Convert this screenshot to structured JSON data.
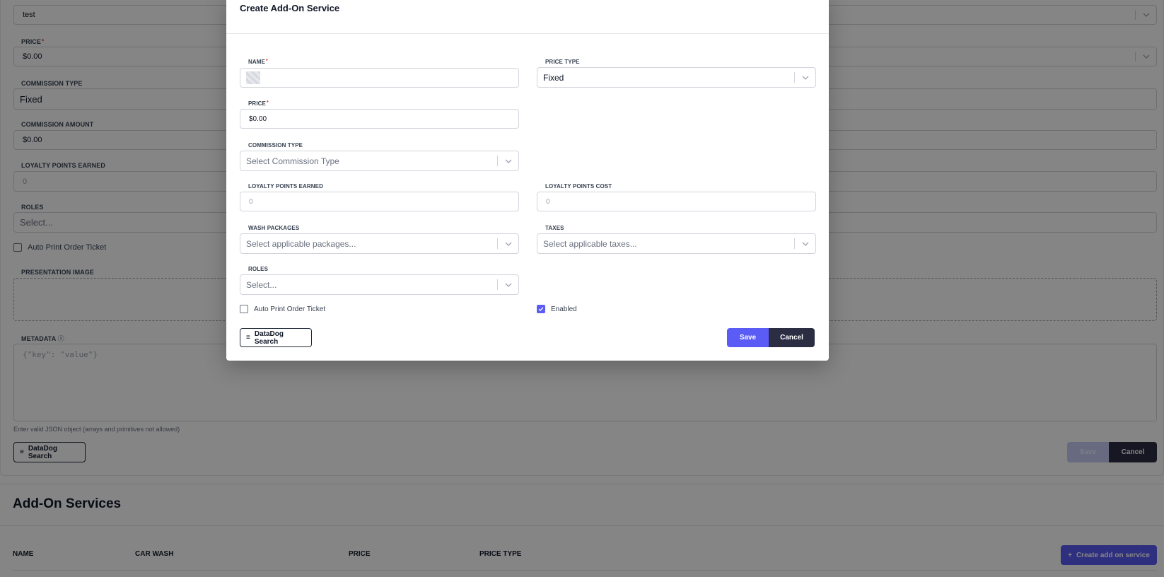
{
  "background_form": {
    "name_value": "test",
    "price_label": "PRICE",
    "price_value": "$0.00",
    "commission_type_label": "COMMISSION TYPE",
    "commission_type_value": "Fixed",
    "commission_amount_label": "COMMISSION AMOUNT",
    "commission_amount_value": "$0.00",
    "loyalty_points_earned_label": "LOYALTY POINTS EARNED",
    "loyalty_points_earned_placeholder": "0",
    "roles_label": "ROLES",
    "roles_placeholder": "Select...",
    "auto_print_label": "Auto Print Order Ticket",
    "presentation_image_label": "PRESENTATION IMAGE",
    "metadata_label": "METADATA",
    "metadata_info_icon": "info-icon",
    "metadata_placeholder": "{\"key\": \"value\"}",
    "metadata_helper": "Enter valid JSON object (arrays and primitives not allowed)",
    "datadog_label": "DataDog Search",
    "save_label": "Save",
    "cancel_label": "Cancel"
  },
  "addon_section": {
    "title": "Add-On Services",
    "columns": [
      "NAME",
      "CAR WASH",
      "PRICE",
      "PRICE TYPE"
    ],
    "create_button_label": "Create add on service",
    "create_button_icon": "plus-icon"
  },
  "modal": {
    "title": "Create Add-On Service",
    "name_label": "NAME",
    "name_value": "",
    "price_type_label": "PRICE TYPE",
    "price_type_value": "Fixed",
    "price_label": "PRICE",
    "price_value": "$0.00",
    "commission_type_label": "COMMISSION TYPE",
    "commission_type_placeholder": "Select Commission Type",
    "loyalty_points_earned_label": "LOYALTY POINTS EARNED",
    "loyalty_points_earned_placeholder": "0",
    "loyalty_points_cost_label": "LOYALTY POINTS COST",
    "loyalty_points_cost_placeholder": "0",
    "wash_packages_label": "WASH PACKAGES",
    "wash_packages_placeholder": "Select applicable packages...",
    "taxes_label": "TAXES",
    "taxes_placeholder": "Select applicable taxes...",
    "roles_label": "ROLES",
    "roles_placeholder": "Select...",
    "auto_print_label": "Auto Print Order Ticket",
    "auto_print_checked": false,
    "enabled_label": "Enabled",
    "enabled_checked": true,
    "datadog_label": "DataDog Search",
    "datadog_icon": "list-icon",
    "save_label": "Save",
    "cancel_label": "Cancel"
  },
  "colors": {
    "primary": "#5b5bf6",
    "dark": "#2b2d42",
    "overlay": "rgba(0,0,0,0.48)",
    "required": "#dc2626"
  }
}
